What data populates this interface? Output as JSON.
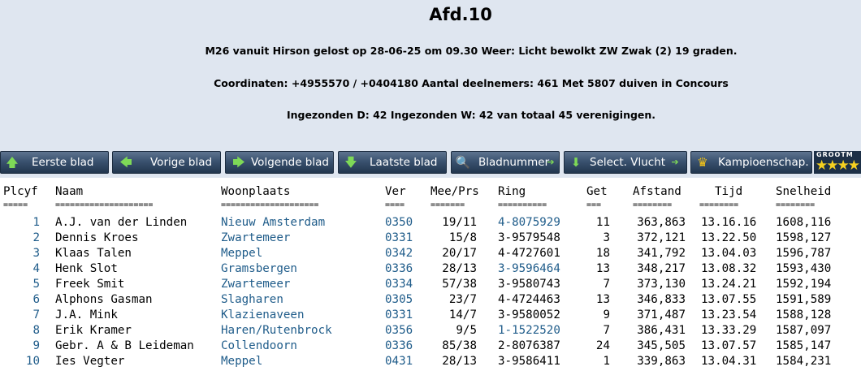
{
  "header": {
    "title": "Afd.10",
    "line1": "M26 vanuit Hirson gelost op 28-06-25 om 09.30 Weer: Licht bewolkt ZW Zwak (2) 19 graden.",
    "line2": "Coordinaten: +4955570 / +0404180 Aantal deelnemers: 461 Met 5807 duiven in Concours",
    "line3": "Ingezonden D: 42 Ingezonden W: 42 van totaal 45 verenigingen."
  },
  "toolbar": {
    "first": "Eerste blad",
    "prev": "Vorige blad",
    "next": "Volgende blad",
    "last": "Laatste blad",
    "page_number": "Bladnummer",
    "select_flight": "Select. Vlucht",
    "championship": "Kampioenschap.",
    "grootm": "GROOTM"
  },
  "table": {
    "headers": [
      "Plcyf",
      "Naam",
      "Woonplaats",
      "Ver",
      "Mee/Prs",
      "Ring",
      "Get",
      "Afstand",
      "Tijd",
      "Snelheid"
    ],
    "separators": [
      "=====",
      "====================",
      "====================",
      "====",
      "=======",
      "==========",
      "===",
      "========",
      "========",
      "========"
    ],
    "rows": [
      {
        "plc": "1",
        "naam": "A.J. van der Linden",
        "woonplaats": "Nieuw Amsterdam",
        "ver": "0350",
        "meeprs": "19/11",
        "ring": "4-8075929",
        "get": "11",
        "afstand": "363,863",
        "tijd": "13.16.16",
        "snelheid": "1608,116"
      },
      {
        "plc": "2",
        "naam": "Dennis Kroes",
        "woonplaats": "Zwartemeer",
        "ver": "0331",
        "meeprs": "15/8",
        "ring": "3-9579548",
        "get": "3",
        "afstand": "372,121",
        "tijd": "13.22.50",
        "snelheid": "1598,127"
      },
      {
        "plc": "3",
        "naam": "Klaas Talen",
        "woonplaats": "Meppel",
        "ver": "0342",
        "meeprs": "20/17",
        "ring": "4-4727601",
        "get": "18",
        "afstand": "341,792",
        "tijd": "13.04.03",
        "snelheid": "1596,787"
      },
      {
        "plc": "4",
        "naam": "Henk Slot",
        "woonplaats": "Gramsbergen",
        "ver": "0336",
        "meeprs": "28/13",
        "ring": "3-9596464",
        "get": "13",
        "afstand": "348,217",
        "tijd": "13.08.32",
        "snelheid": "1593,430"
      },
      {
        "plc": "5",
        "naam": "Freek Smit",
        "woonplaats": "Zwartemeer",
        "ver": "0334",
        "meeprs": "57/38",
        "ring": "3-9580743",
        "get": "7",
        "afstand": "373,130",
        "tijd": "13.24.21",
        "snelheid": "1592,194"
      },
      {
        "plc": "6",
        "naam": "Alphons Gasman",
        "woonplaats": "Slagharen",
        "ver": "0305",
        "meeprs": "23/7",
        "ring": "4-4724463",
        "get": "13",
        "afstand": "346,833",
        "tijd": "13.07.55",
        "snelheid": "1591,589"
      },
      {
        "plc": "7",
        "naam": "J.A. Mink",
        "woonplaats": "Klazienaveen",
        "ver": "0331",
        "meeprs": "14/7",
        "ring": "3-9580052",
        "get": "9",
        "afstand": "371,487",
        "tijd": "13.23.54",
        "snelheid": "1588,128"
      },
      {
        "plc": "8",
        "naam": "Erik Kramer",
        "woonplaats": "Haren/Rutenbrock",
        "ver": "0356",
        "meeprs": "9/5",
        "ring": "1-1522520",
        "get": "7",
        "afstand": "386,431",
        "tijd": "13.33.29",
        "snelheid": "1587,097"
      },
      {
        "plc": "9",
        "naam": "Gebr. A & B Leideman",
        "woonplaats": "Collendoorn",
        "ver": "0336",
        "meeprs": "85/38",
        "ring": "2-8076387",
        "get": "24",
        "afstand": "345,505",
        "tijd": "13.07.57",
        "snelheid": "1585,147"
      },
      {
        "plc": "10",
        "naam": "Ies Vegter",
        "woonplaats": "Meppel",
        "ver": "0431",
        "meeprs": "28/13",
        "ring": "3-9586411",
        "get": "1",
        "afstand": "339,863",
        "tijd": "13.04.31",
        "snelheid": "1584,231"
      }
    ],
    "ring_links": [
      true,
      false,
      false,
      true,
      false,
      false,
      false,
      true,
      false,
      false
    ]
  },
  "colors": {
    "header_bg": "#dfe6f0",
    "link": "#1f5c8a",
    "button_dark": "#22364e",
    "button_light": "#5d738f"
  }
}
